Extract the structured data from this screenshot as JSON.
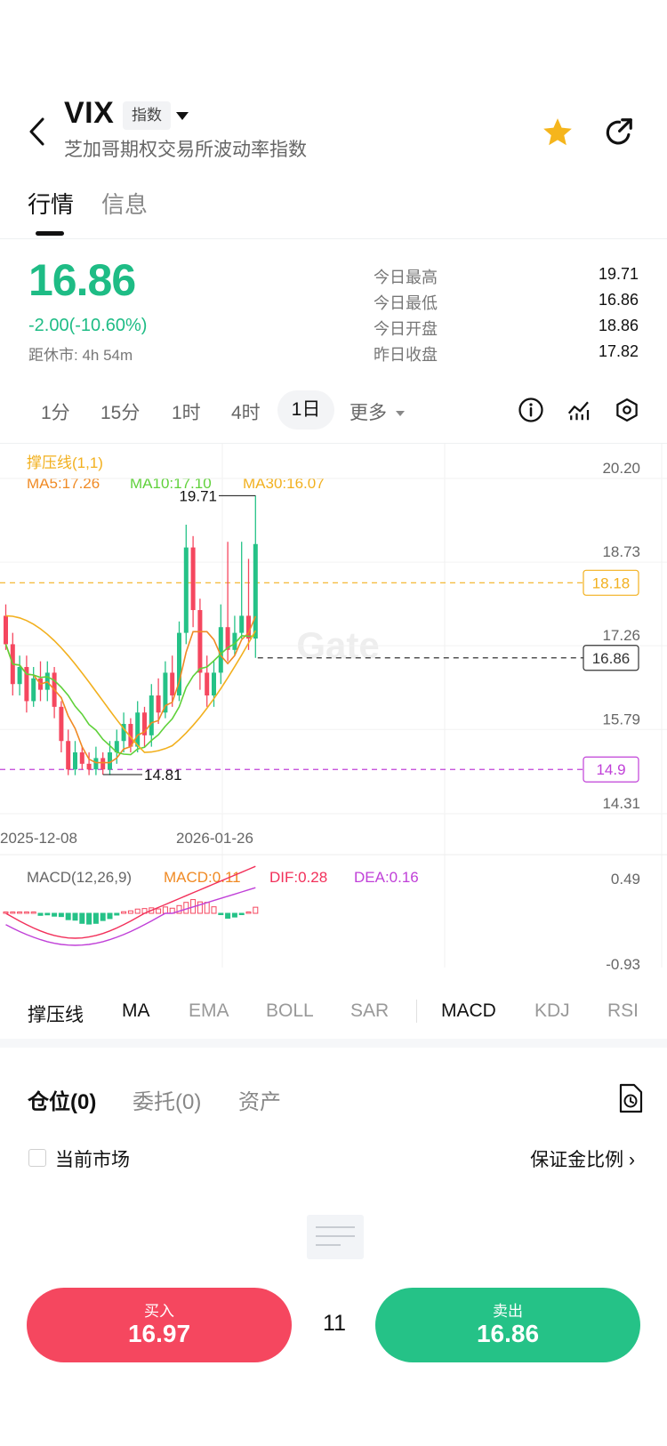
{
  "header": {
    "symbol": "VIX",
    "tag": "指数",
    "full_name": "芝加哥期权交易所波动率指数"
  },
  "tabs": [
    {
      "label": "行情",
      "active": true
    },
    {
      "label": "信息",
      "active": false
    }
  ],
  "quote": {
    "price": "16.86",
    "change": "-2.00(-10.60%)",
    "market_close": "距休市: 4h 54m",
    "color_down": "#1ebc85",
    "stats": [
      {
        "label": "今日最高",
        "value": "19.71"
      },
      {
        "label": "今日最低",
        "value": "16.86"
      },
      {
        "label": "今日开盘",
        "value": "18.86"
      },
      {
        "label": "昨日收盘",
        "value": "17.82"
      }
    ]
  },
  "periods": [
    "1分",
    "15分",
    "1时",
    "4时",
    "1日",
    "更多"
  ],
  "selected_period": "1日",
  "chart_data": {
    "type": "candlestick",
    "indicator_title": "撑压线(1,1)",
    "ma_labels": [
      {
        "text": "MA5:17.26",
        "color": "#f08a24"
      },
      {
        "text": "MA10:17.10",
        "color": "#5fd13a"
      },
      {
        "text": "MA30:16.07",
        "color": "#f2b01e"
      }
    ],
    "y_ticks": [
      "20.20",
      "18.73",
      "17.26",
      "15.79",
      "14.31"
    ],
    "ylim": [
      14.31,
      20.2
    ],
    "x_labels": [
      "2025-12-08",
      "2026-01-26"
    ],
    "high_label": "19.71",
    "low_label": "14.81",
    "price_tags": [
      {
        "value": "18.18",
        "color": "#f2b01e"
      },
      {
        "value": "16.86",
        "color": "#333333"
      },
      {
        "value": "14.9",
        "color": "#c040d8"
      }
    ],
    "watermark": "Gate",
    "candles": [
      [
        17.6,
        17.1,
        17.8,
        17.0
      ],
      [
        17.1,
        16.4,
        17.3,
        16.2
      ],
      [
        16.4,
        16.7,
        16.9,
        16.2
      ],
      [
        16.7,
        16.1,
        16.9,
        15.9
      ],
      [
        16.1,
        16.5,
        16.7,
        16.0
      ],
      [
        16.5,
        16.3,
        16.8,
        16.1
      ],
      [
        16.3,
        16.6,
        16.8,
        16.1
      ],
      [
        16.6,
        16.0,
        16.7,
        15.8
      ],
      [
        16.0,
        15.4,
        16.1,
        15.2
      ],
      [
        15.4,
        14.9,
        15.6,
        14.8
      ],
      [
        14.9,
        15.2,
        15.4,
        14.8
      ],
      [
        15.2,
        15.0,
        15.3,
        14.9
      ],
      [
        15.0,
        14.9,
        15.2,
        14.8
      ],
      [
        14.9,
        15.1,
        15.3,
        14.8
      ],
      [
        15.1,
        14.9,
        15.2,
        14.81
      ],
      [
        14.9,
        15.2,
        15.4,
        14.8
      ],
      [
        15.2,
        15.4,
        15.6,
        15.0
      ],
      [
        15.4,
        15.7,
        15.9,
        15.2
      ],
      [
        15.7,
        15.3,
        15.8,
        15.2
      ],
      [
        15.3,
        15.9,
        16.1,
        15.2
      ],
      [
        15.9,
        15.5,
        16.0,
        15.3
      ],
      [
        15.5,
        16.2,
        16.4,
        15.3
      ],
      [
        16.2,
        15.9,
        16.5,
        15.7
      ],
      [
        15.9,
        16.6,
        16.8,
        15.8
      ],
      [
        16.6,
        16.2,
        16.9,
        16.0
      ],
      [
        16.2,
        17.3,
        17.5,
        16.1
      ],
      [
        17.3,
        18.8,
        19.2,
        17.1
      ],
      [
        18.8,
        17.7,
        19.0,
        17.4
      ],
      [
        17.7,
        16.6,
        17.9,
        16.3
      ],
      [
        16.6,
        16.2,
        16.9,
        16.0
      ],
      [
        16.2,
        16.6,
        16.8,
        16.0
      ],
      [
        16.6,
        17.4,
        17.8,
        16.4
      ],
      [
        17.4,
        17.0,
        18.9,
        16.8
      ],
      [
        17.0,
        17.3,
        17.6,
        16.9
      ],
      [
        17.3,
        17.6,
        18.9,
        17.2
      ],
      [
        17.6,
        17.2,
        18.6,
        17.0
      ],
      [
        17.2,
        18.86,
        19.71,
        16.86
      ]
    ],
    "macd": {
      "title": "MACD(12,26,9)",
      "macd": "MACD:0.11",
      "dif": "DIF:0.28",
      "dea": "DEA:0.16",
      "y_top": "0.49",
      "y_bottom": "-0.93"
    }
  },
  "indicators": {
    "main": [
      "撑压线",
      "MA",
      "EMA",
      "BOLL",
      "SAR"
    ],
    "main_on": [
      "撑压线",
      "MA"
    ],
    "sub": [
      "MACD",
      "KDJ",
      "RSI"
    ],
    "sub_on": [
      "MACD"
    ]
  },
  "positions": {
    "tabs": [
      "仓位(0)",
      "委托(0)",
      "资产"
    ],
    "current_market": "当前市场",
    "margin_ratio": "保证金比例 ›"
  },
  "trade": {
    "buy_label": "买入",
    "buy_price": "16.97",
    "spread": "11",
    "sell_label": "卖出",
    "sell_price": "16.86",
    "buy_color": "#f5475f",
    "sell_color": "#25c287"
  }
}
